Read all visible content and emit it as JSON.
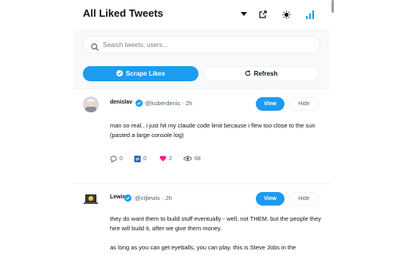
{
  "header": {
    "title": "All Liked Tweets"
  },
  "search": {
    "placeholder": "Search tweets, users..."
  },
  "actions": {
    "scrape_label": "Scrape Likes",
    "refresh_label": "Refresh"
  },
  "colors": {
    "accent": "#1d9bf0",
    "like": "#f91880",
    "text_primary": "#0f1419",
    "text_secondary": "#536471"
  },
  "tweets": [
    {
      "display_name": "denislav",
      "handle": "@kuberdenis",
      "separator": "·",
      "time": "2h",
      "view_label": "View",
      "hide_label": "Hide",
      "text": "man so real.. i just hit my claude code limit because i flew too close to the sun (pasted a large console log)",
      "stats": {
        "replies": "0",
        "retweets": "0",
        "likes": "2",
        "views": "68"
      }
    },
    {
      "display_name": "Lewis",
      "handle": "@ctjlewis",
      "separator": "·",
      "time": "2h",
      "view_label": "View",
      "hide_label": "Hide",
      "text": "they do want them to build stuff eventually - well, not THEM. but the people they hire will build it, after we give them money.",
      "text2": "as long as you can get eyeballs, you can play. this is Steve Jobs in the"
    }
  ]
}
